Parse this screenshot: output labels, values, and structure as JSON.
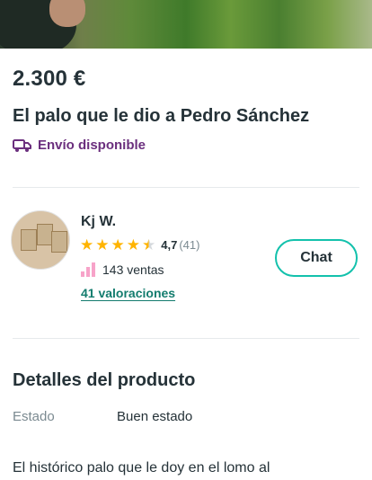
{
  "product": {
    "price": "2.300 €",
    "title": "El palo que le dio a Pedro Sánchez",
    "shipping_label": "Envío disponible",
    "shipping_icon": "truck-icon",
    "accent_purple": "#6b2f7e"
  },
  "seller": {
    "name": "Kj W.",
    "rating_score": "4,7",
    "rating_count": "(41)",
    "stars": 4.5,
    "sales": "143 ventas",
    "reviews_link": "41 valoraciones",
    "chat_label": "Chat",
    "accent_teal": "#13c1ac"
  },
  "details": {
    "section_title": "Detalles del producto",
    "condition_label": "Estado",
    "condition_value": "Buen estado",
    "description": "El histórico palo que le doy en el lomo al"
  }
}
